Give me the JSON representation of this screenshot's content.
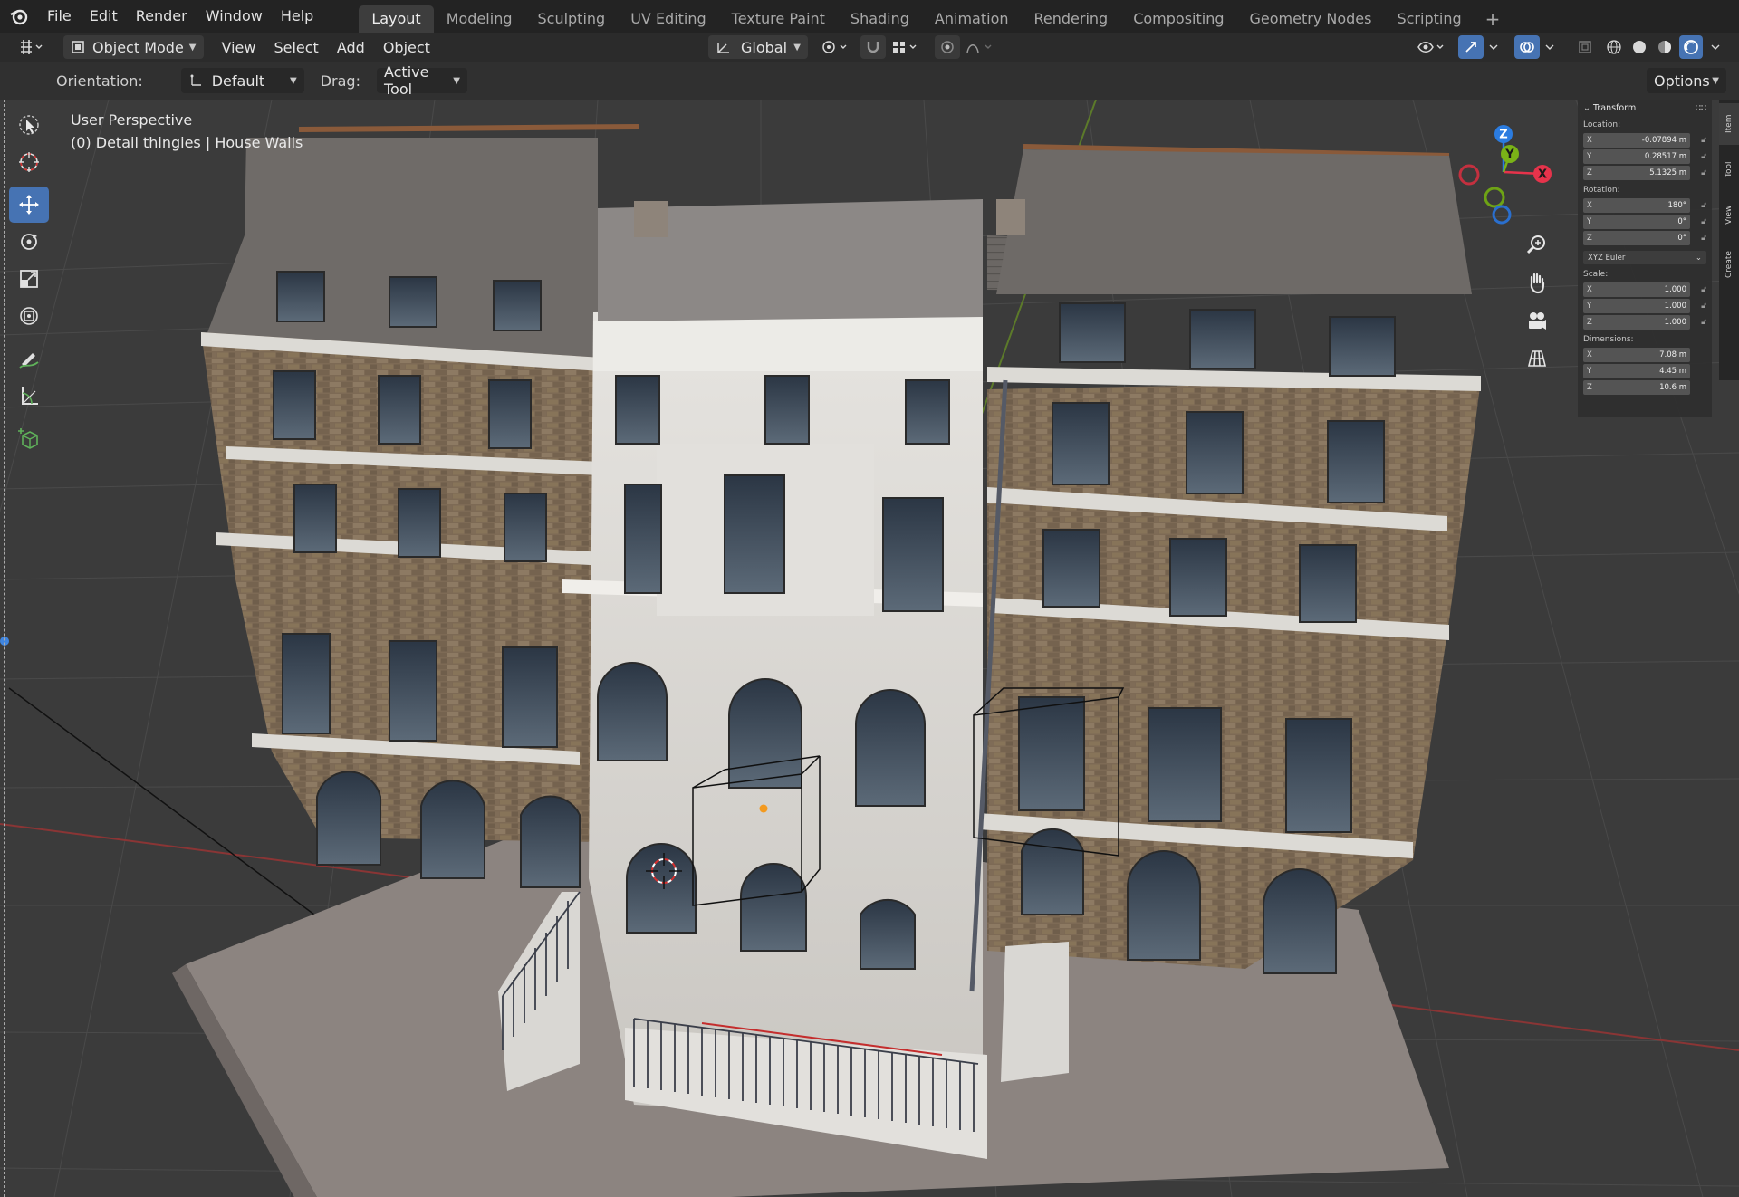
{
  "menu": [
    "File",
    "Edit",
    "Render",
    "Window",
    "Help"
  ],
  "workspaces": [
    {
      "label": "Layout",
      "active": true
    },
    {
      "label": "Modeling"
    },
    {
      "label": "Sculpting"
    },
    {
      "label": "UV Editing"
    },
    {
      "label": "Texture Paint"
    },
    {
      "label": "Shading"
    },
    {
      "label": "Animation"
    },
    {
      "label": "Rendering"
    },
    {
      "label": "Compositing"
    },
    {
      "label": "Geometry Nodes"
    },
    {
      "label": "Scripting"
    }
  ],
  "add_workspace": "+",
  "header": {
    "mode": "Object Mode",
    "menus": [
      "View",
      "Select",
      "Add",
      "Object"
    ],
    "transform_orientation": "Global"
  },
  "tool_settings": {
    "orientation_label": "Orientation:",
    "orientation_value": "Default",
    "drag_label": "Drag:",
    "drag_value": "Active Tool",
    "options": "Options"
  },
  "viewport": {
    "perspective": "User Perspective",
    "collection": "(0) Detail thingies | House Walls"
  },
  "gizmo": {
    "x": "X",
    "y": "Y",
    "z": "Z"
  },
  "colors": {
    "accent": "#4673b3",
    "axis_x": "#e6334b",
    "axis_y": "#7ab317",
    "axis_z": "#2b7ce0"
  },
  "toolbar_icons": [
    "select-box-icon",
    "cursor-icon",
    "move-icon",
    "rotate-icon",
    "scale-icon",
    "transform-icon",
    "annotate-icon",
    "measure-icon",
    "add-cube-icon"
  ],
  "n_panel": {
    "section": "Transform",
    "location_label": "Location:",
    "location": [
      {
        "axis": "X",
        "value": "-0.07894 m"
      },
      {
        "axis": "Y",
        "value": "0.28517 m"
      },
      {
        "axis": "Z",
        "value": "5.1325 m"
      }
    ],
    "rotation_label": "Rotation:",
    "rotation": [
      {
        "axis": "X",
        "value": "180°"
      },
      {
        "axis": "Y",
        "value": "0°"
      },
      {
        "axis": "Z",
        "value": "0°"
      }
    ],
    "rotation_mode": "XYZ Euler",
    "scale_label": "Scale:",
    "scale": [
      {
        "axis": "X",
        "value": "1.000"
      },
      {
        "axis": "Y",
        "value": "1.000"
      },
      {
        "axis": "Z",
        "value": "1.000"
      }
    ],
    "dimensions_label": "Dimensions:",
    "dimensions": [
      {
        "axis": "X",
        "value": "7.08 m"
      },
      {
        "axis": "Y",
        "value": "4.45 m"
      },
      {
        "axis": "Z",
        "value": "10.6 m"
      }
    ]
  },
  "side_tabs": [
    "Item",
    "Tool",
    "View",
    "Create"
  ]
}
